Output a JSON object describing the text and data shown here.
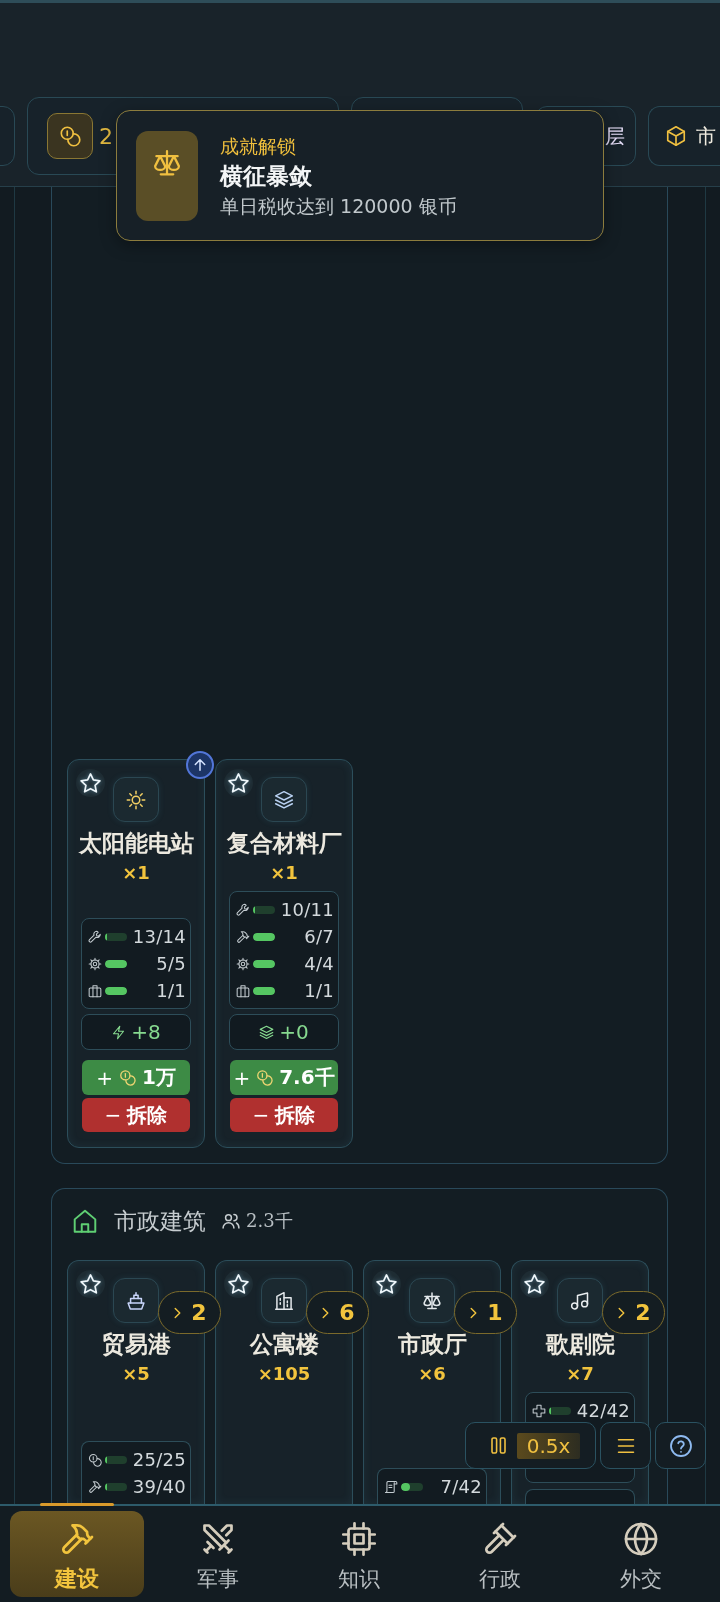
{
  "resource_bar": [
    {
      "kind": "partial"
    },
    {
      "kind": "coins",
      "value": "2"
    },
    {
      "kind": "population"
    },
    {
      "kind": "class",
      "label": "层"
    },
    {
      "kind": "market",
      "label": "市"
    }
  ],
  "toast": {
    "title": "成就解锁",
    "name": "横征暴敛",
    "description": "单日税收达到 120000 银币"
  },
  "sections": [
    {
      "kind": "industry",
      "buildings": [
        {
          "kind": "solar",
          "name": "太阳能电站",
          "count": "×1",
          "favorite": false,
          "upgrade": true,
          "panels": [
            {
              "kind": "stats",
              "rows": [
                {
                  "kind": "tools",
                  "level": 0.1,
                  "value": "13/14"
                },
                {
                  "kind": "machinery",
                  "level": 1,
                  "value": "5/5"
                },
                {
                  "kind": "office",
                  "level": 1,
                  "value": "1/1"
                }
              ]
            },
            {
              "kind": "power",
              "value": "+8"
            }
          ],
          "build": {
            "sign": "+",
            "cost": "1万"
          },
          "demolish": {
            "sign": "−",
            "label": "拆除"
          }
        },
        {
          "kind": "composite",
          "name": "复合材料厂",
          "count": "×1",
          "favorite": false,
          "upgrade": false,
          "panels": [
            {
              "kind": "stats",
              "rows": [
                {
                  "kind": "tools",
                  "level": 0.1,
                  "value": "10/11"
                },
                {
                  "kind": "labor",
                  "level": 1,
                  "value": "6/7"
                },
                {
                  "kind": "machinery",
                  "level": 1,
                  "value": "4/4"
                },
                {
                  "kind": "office",
                  "level": 1,
                  "value": "1/1"
                }
              ]
            },
            {
              "kind": "materials",
              "value": "+0"
            }
          ],
          "build": {
            "sign": "+",
            "cost": "7.6千"
          },
          "demolish": {
            "sign": "−",
            "label": "拆除"
          }
        }
      ]
    },
    {
      "kind": "civic",
      "title": "市政建筑",
      "population": "2.3千",
      "buildings": [
        {
          "kind": "port",
          "name": "贸易港",
          "count": "×5",
          "favorite": false,
          "upgrade": false,
          "queue": "2",
          "panels": [
            {
              "kind": "stats",
              "rows": [
                {
                  "kind": "money",
                  "level": 0.1,
                  "value": "25/25"
                },
                {
                  "kind": "labor",
                  "level": 0.1,
                  "value": "39/40"
                }
              ]
            }
          ]
        },
        {
          "kind": "apartment",
          "name": "公寓楼",
          "count": "×105",
          "favorite": false,
          "upgrade": false,
          "queue": "6"
        },
        {
          "kind": "cityhall",
          "name": "市政厅",
          "count": "×6",
          "favorite": false,
          "upgrade": false,
          "queue": "1",
          "panels": [
            {
              "kind": "stats",
              "rows": [
                {
                  "kind": "paper",
                  "level": 0.4,
                  "value": "7/42"
                }
              ]
            }
          ]
        },
        {
          "kind": "opera",
          "name": "歌剧院",
          "count": "×7",
          "favorite": false,
          "upgrade": false,
          "queue": "2",
          "panels": [
            {
              "kind": "stats",
              "rows": [
                {
                  "kind": "health",
                  "level": 0.1,
                  "value": "42/42"
                },
                {
                  "kind": "covered"
                },
                {
                  "kind": "covered"
                }
              ]
            },
            {
              "kind": "output"
            }
          ]
        }
      ]
    }
  ],
  "speed_control": {
    "speed": "0.5x"
  },
  "tabs": [
    {
      "kind": "build",
      "label": "建设",
      "selected": true
    },
    {
      "kind": "military",
      "label": "军事",
      "selected": false
    },
    {
      "kind": "knowledge",
      "label": "知识",
      "selected": false
    },
    {
      "kind": "admin",
      "label": "行政",
      "selected": false
    },
    {
      "kind": "diplomacy",
      "label": "外交",
      "selected": false
    }
  ]
}
